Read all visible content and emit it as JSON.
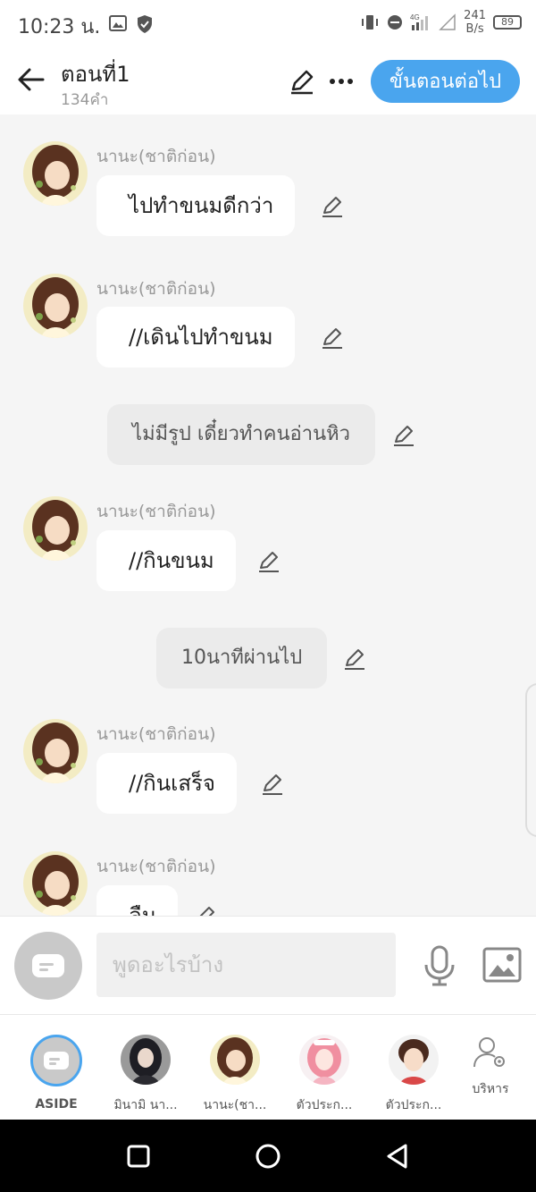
{
  "status_bar": {
    "time": "10:23 น.",
    "network_speed_value": "241",
    "network_speed_unit": "B/s",
    "battery": "89"
  },
  "header": {
    "title": "ตอนที่1",
    "word_count": "134คำ",
    "next_button": "ขั้นตอนต่อไป"
  },
  "messages": [
    {
      "type": "character",
      "sender": "นานะ(ชาติก่อน)",
      "text": "ไปทำขนมดีกว่า"
    },
    {
      "type": "character",
      "sender": "นานะ(ชาติก่อน)",
      "text": "//เดินไปทำขนม"
    },
    {
      "type": "narration",
      "text": "ไม่มีรูป เดี๋ยวทำคนอ่านหิว"
    },
    {
      "type": "character",
      "sender": "นานะ(ชาติก่อน)",
      "text": "//กินขนม"
    },
    {
      "type": "narration",
      "text": "10นาทีผ่านไป"
    },
    {
      "type": "character",
      "sender": "นานะ(ชาติก่อน)",
      "text": "//กินเสร็จ"
    },
    {
      "type": "character",
      "sender": "นานะ(ชาติก่อน)",
      "text": "ลืม"
    }
  ],
  "input": {
    "placeholder": "พูดอะไรบ้าง"
  },
  "characters": [
    {
      "label": "ASIDE"
    },
    {
      "label": "มินามิ นา..."
    },
    {
      "label": "นานะ(ชา..."
    },
    {
      "label": "ตัวประก..."
    },
    {
      "label": "ตัวประก..."
    },
    {
      "label": "บริหาร"
    }
  ],
  "colors": {
    "accent": "#4aa5ee",
    "background": "#f5f5f5",
    "narration_bubble": "#ebebeb"
  }
}
